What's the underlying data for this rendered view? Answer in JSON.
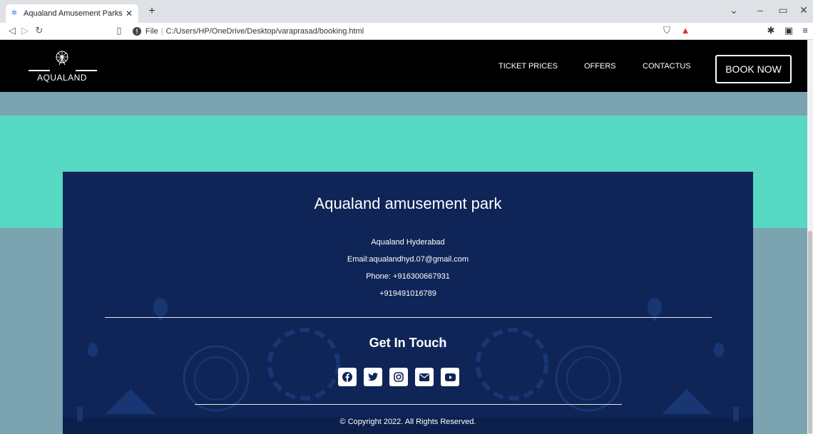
{
  "browser": {
    "tab_title": "Aqualand Amusement Parks & Re",
    "tab_close": "✕",
    "new_tab": "+",
    "url_scheme": "File",
    "url": "C:/Users/HP/OneDrive/Desktop/varaprasad/booking.html",
    "icons": [
      "back-icon",
      "forward-icon",
      "reload-icon",
      "bookmark-icon",
      "info-icon",
      "brave-shield-icon",
      "brave-rewards-icon",
      "extensions-icon",
      "wallet-icon",
      "menu-icon",
      "minimize-icon",
      "maximize-icon",
      "close-icon",
      "tab-search-icon"
    ]
  },
  "header": {
    "logo_text": "AQUALAND",
    "nav": [
      "TICKET PRICES",
      "OFFERS",
      "CONTACTUS"
    ],
    "cta": "BOOK NOW"
  },
  "footer": {
    "title": "Aqualand amusement park",
    "address": "Aqualand Hyderabad",
    "email": "Email:aqualandhyd.07@gmail.com",
    "phone1": "Phone: +916300667931",
    "phone2": "+919491016789",
    "get_in_touch": "Get In Touch",
    "social_icons": [
      "facebook-icon",
      "twitter-icon",
      "instagram-icon",
      "email-icon",
      "youtube-icon"
    ],
    "copyright": "© Copyright 2022. All Rights Reserved."
  },
  "colors": {
    "header_bg": "#000000",
    "page_bg": "#7ba3b0",
    "teal_band": "#56d8c3",
    "footer_bg": "#0f2557"
  }
}
